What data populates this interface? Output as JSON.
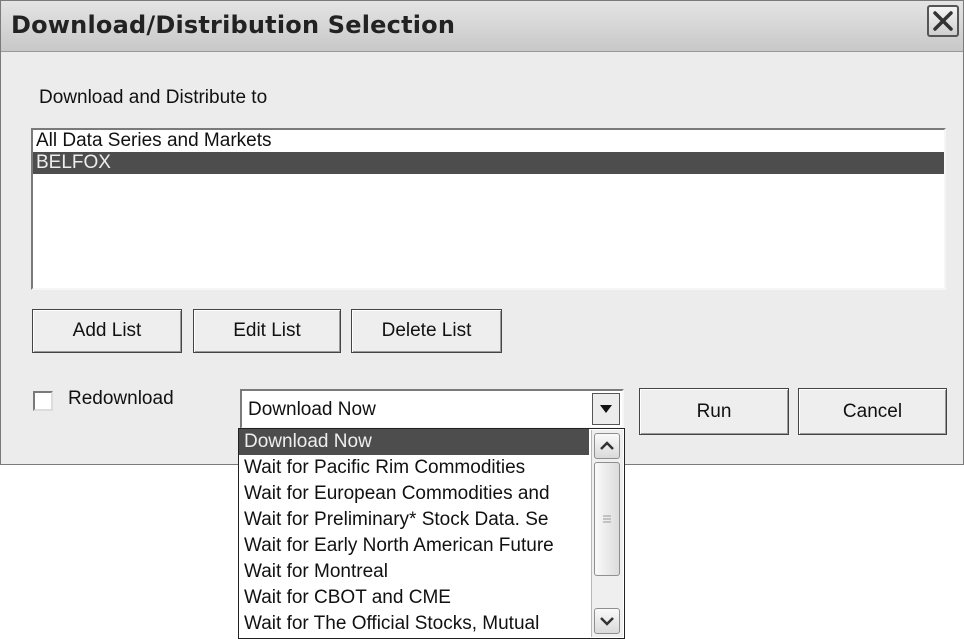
{
  "window": {
    "title": "Download/Distribution Selection",
    "close_icon": "close-x-icon"
  },
  "section_label": "Download and Distribute to",
  "distribution_list": {
    "items": [
      "All Data Series and Markets",
      "BELFOX"
    ],
    "selected": "BELFOX"
  },
  "buttons": {
    "add_list": "Add List",
    "edit_list": "Edit List",
    "delete_list": "Delete List",
    "run": "Run",
    "cancel": "Cancel"
  },
  "redownload": {
    "label": "Redownload",
    "checked": false
  },
  "timing_select": {
    "value": "Download Now",
    "options": [
      "Download Now",
      "Wait for Pacific Rim Commodities",
      "Wait for European Commodities and",
      "Wait for Preliminary* Stock Data.  Se",
      "Wait for Early North American Future",
      "Wait for Montreal",
      "Wait for CBOT and CME",
      "Wait for The Official Stocks, Mutual"
    ]
  },
  "colors": {
    "selection": "#4d4d4d",
    "dialog_bg": "#ececec"
  }
}
